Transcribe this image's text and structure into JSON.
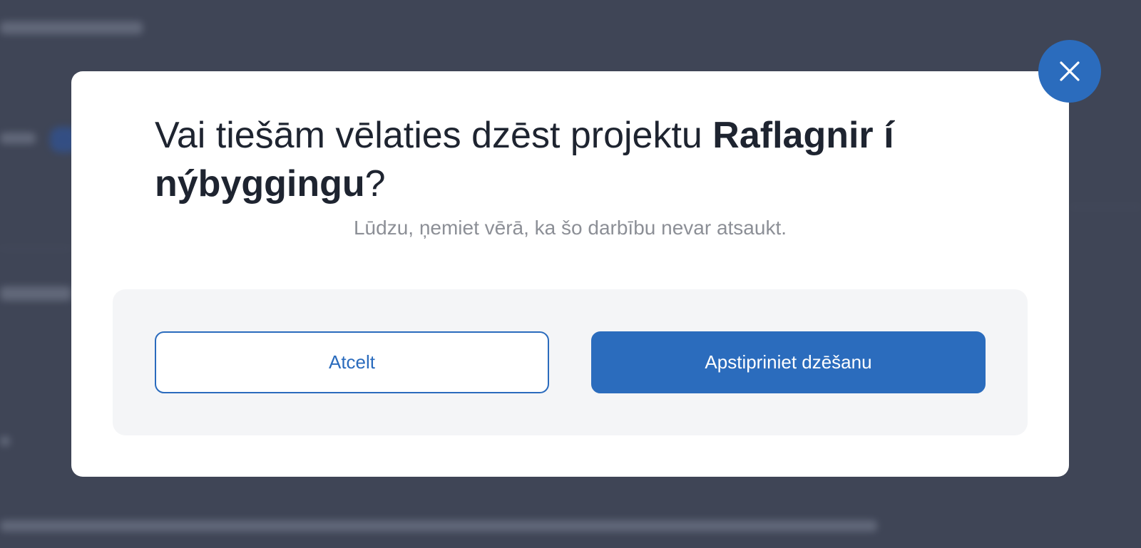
{
  "dialog": {
    "title_prefix": "Vai tiešām vēlaties dzēst projektu ",
    "project_name": "Raflagnir í nýbyggingu",
    "title_suffix": "?",
    "subtitle": "Lūdzu, ņemiet vērā, ka šo darbību nevar atsaukt.",
    "cancel_label": "Atcelt",
    "confirm_label": "Apstipriniet dzēšanu",
    "close_icon": "close-icon"
  },
  "colors": {
    "accent": "#2b6cbd",
    "overlay": "#3f4556",
    "panel": "#f4f5f7"
  }
}
